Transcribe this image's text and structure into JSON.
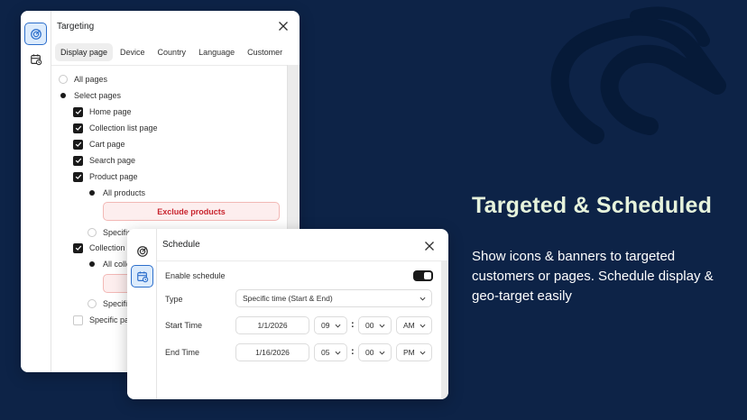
{
  "hero": {
    "title": "Targeted & Scheduled",
    "description": "Show icons & banners to targeted customers or pages. Schedule display & geo-target easily"
  },
  "targeting": {
    "title": "Targeting",
    "tabs": [
      "Display page",
      "Device",
      "Country",
      "Language",
      "Customer"
    ],
    "selected_tab": "Display page",
    "options": {
      "all_pages": "All pages",
      "select_pages": "Select pages",
      "home_page": "Home page",
      "collection_list_page": "Collection list page",
      "cart_page": "Cart page",
      "search_page": "Search page",
      "product_page": "Product page",
      "all_products": "All products",
      "exclude_products": "Exclude products",
      "specific_products": "Specific",
      "collection_page": "Collection p",
      "all_collections": "All colle",
      "specific_collections": "Specifi",
      "specific_pages": "Specific pa"
    }
  },
  "schedule": {
    "title": "Schedule",
    "enable_label": "Enable schedule",
    "enabled": true,
    "type_label": "Type",
    "type_value": "Specific time (Start & End)",
    "start_label": "Start Time",
    "start_date": "1/1/2026",
    "start_hour": "09",
    "start_minute": "00",
    "start_period": "AM",
    "end_label": "End Time",
    "end_date": "1/16/2026",
    "end_hour": "05",
    "end_minute": "00",
    "end_period": "PM",
    "colon": ":"
  },
  "colors": {
    "background": "#0d2347",
    "accent": "#2c6ecb",
    "title_green": "#e6f3dc",
    "exclude_red": "#c8242e"
  },
  "icons": [
    "target-icon",
    "calendar-clock-icon",
    "close-icon",
    "checkmark-icon",
    "chevron-down-icon",
    "brand-logo-icon"
  ]
}
